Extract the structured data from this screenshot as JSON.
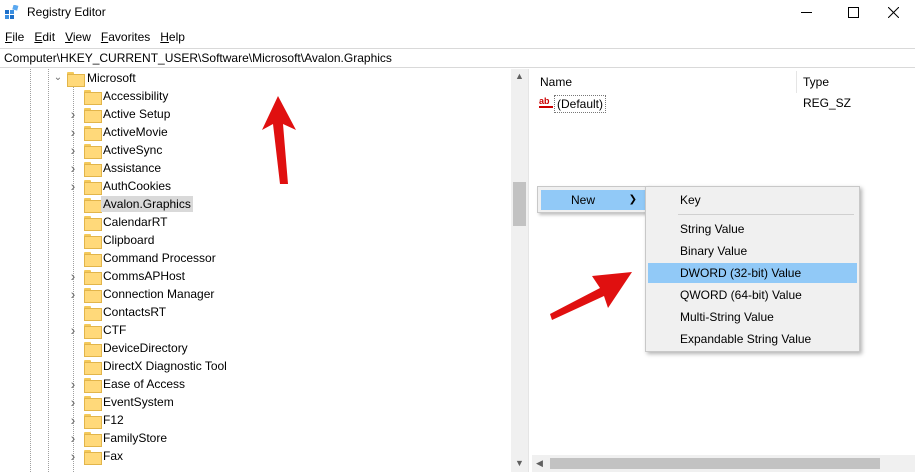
{
  "window": {
    "title": "Registry Editor",
    "icon": "registry-icon"
  },
  "menu": [
    {
      "label": "File",
      "accel": "F",
      "rest": "ile"
    },
    {
      "label": "Edit",
      "accel": "E",
      "rest": "dit"
    },
    {
      "label": "View",
      "accel": "V",
      "rest": "iew"
    },
    {
      "label": "Favorites",
      "accel": "F",
      "rest": "avorites"
    },
    {
      "label": "Help",
      "accel": "H",
      "rest": "elp"
    }
  ],
  "address": "Computer\\HKEY_CURRENT_USER\\Software\\Microsoft\\Avalon.Graphics",
  "tree": {
    "parent": "Microsoft",
    "selected": "Avalon.Graphics",
    "children": [
      {
        "label": "Accessibility",
        "expandable": false
      },
      {
        "label": "Active Setup",
        "expandable": true
      },
      {
        "label": "ActiveMovie",
        "expandable": true
      },
      {
        "label": "ActiveSync",
        "expandable": true
      },
      {
        "label": "Assistance",
        "expandable": true
      },
      {
        "label": "AuthCookies",
        "expandable": true
      },
      {
        "label": "Avalon.Graphics",
        "expandable": false
      },
      {
        "label": "CalendarRT",
        "expandable": false
      },
      {
        "label": "Clipboard",
        "expandable": false
      },
      {
        "label": "Command Processor",
        "expandable": false
      },
      {
        "label": "CommsAPHost",
        "expandable": true
      },
      {
        "label": "Connection Manager",
        "expandable": true
      },
      {
        "label": "ContactsRT",
        "expandable": false
      },
      {
        "label": "CTF",
        "expandable": true
      },
      {
        "label": "DeviceDirectory",
        "expandable": false
      },
      {
        "label": "DirectX Diagnostic Tool",
        "expandable": false
      },
      {
        "label": "Ease of Access",
        "expandable": true
      },
      {
        "label": "EventSystem",
        "expandable": true
      },
      {
        "label": "F12",
        "expandable": true
      },
      {
        "label": "FamilyStore",
        "expandable": true
      },
      {
        "label": "Fax",
        "expandable": true
      }
    ]
  },
  "list": {
    "columns": {
      "name": "Name",
      "type": "Type"
    },
    "rows": [
      {
        "name": "(Default)",
        "type": "REG_SZ",
        "icon": "ab-string-icon"
      }
    ]
  },
  "context_menu": {
    "new_label": "New",
    "submenu": {
      "key": "Key",
      "items": [
        "String Value",
        "Binary Value",
        "DWORD (32-bit) Value",
        "QWORD (64-bit) Value",
        "Multi-String Value",
        "Expandable String Value"
      ],
      "highlighted": "DWORD (32-bit) Value"
    }
  },
  "colors": {
    "highlight": "#91c9f7",
    "annotation_arrow": "#e01010",
    "folder": "#ffd97a"
  }
}
